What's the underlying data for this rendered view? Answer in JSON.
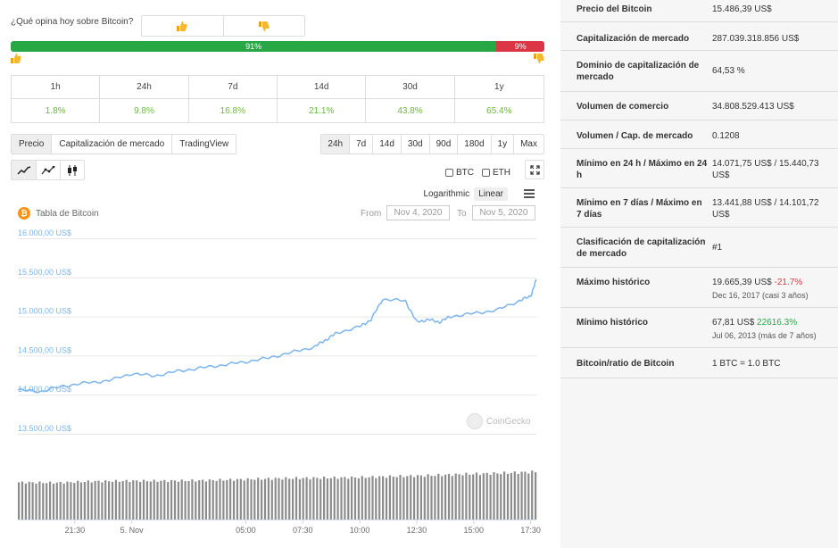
{
  "poll": {
    "question": "¿Qué opina hoy sobre Bitcoin?",
    "up_icon": "thumbs-up",
    "down_icon": "thumbs-down",
    "positive_pct": 91,
    "negative_pct": 9,
    "positive_label": "91%",
    "negative_label": "9%",
    "positive_color": "#28a745",
    "negative_color": "#dc3545"
  },
  "performance": {
    "periods": [
      "1h",
      "24h",
      "7d",
      "14d",
      "30d",
      "1y"
    ],
    "changes": [
      "1.8%",
      "9.8%",
      "16.8%",
      "21.1%",
      "43.8%",
      "65.4%"
    ]
  },
  "tabs": [
    "Precio",
    "Capitalización de mercado",
    "TradingView"
  ],
  "ranges": [
    "24h",
    "7d",
    "14d",
    "30d",
    "90d",
    "180d",
    "1y",
    "Max"
  ],
  "compare": {
    "btc": "BTC",
    "eth": "ETH"
  },
  "scale": {
    "log": "Logarithmic",
    "linear": "Linear"
  },
  "chart_header": {
    "title": "Tabla de Bitcoin",
    "from_label": "From",
    "from_value": "Nov 4, 2020",
    "to_label": "To",
    "to_value": "Nov 5, 2020",
    "watermark": "CoinGecko"
  },
  "chart_data": {
    "type": "line",
    "title": "Tabla de Bitcoin",
    "y_ticks": [
      "16.000,00 US$",
      "15.500,00 US$",
      "15.000,00 US$",
      "14.500,00 US$",
      "14.000,00 US$",
      "13.500,00 US$"
    ],
    "y_tick_values": [
      16000,
      15500,
      15000,
      14500,
      14000,
      13500
    ],
    "ylim": [
      13500,
      16000
    ],
    "x_ticks": [
      "21:30",
      "5. Nov",
      "05:00",
      "07:30",
      "10:00",
      "12:30",
      "15:00",
      "17:30"
    ],
    "series": [
      {
        "x": [
          "19:00",
          "20:00",
          "21:00",
          "22:00",
          "23:00",
          "00:00",
          "01:00",
          "02:00",
          "03:00",
          "04:00",
          "05:00",
          "06:00",
          "07:00",
          "08:00",
          "08:30",
          "09:00",
          "10:00",
          "10:30",
          "11:00",
          "12:00",
          "12:30",
          "13:00",
          "13:30",
          "14:00",
          "15:00",
          "16:00",
          "17:00",
          "17:30",
          "17:45"
        ],
        "values": [
          14060,
          14040,
          14110,
          14150,
          14180,
          14270,
          14240,
          14300,
          14340,
          14380,
          14420,
          14470,
          14540,
          14610,
          14700,
          14790,
          14870,
          14960,
          15220,
          15200,
          14930,
          14960,
          14930,
          15000,
          15040,
          15080,
          15200,
          15260,
          15470
        ],
        "color": "#7cb5ec"
      }
    ],
    "volume_color": "#8c8c8c",
    "volume_relative": [
      0.78,
      0.77,
      0.8,
      0.81,
      0.81,
      0.82,
      0.84,
      0.86,
      0.87,
      0.88,
      0.9,
      0.92,
      0.95,
      0.97,
      1.0
    ],
    "grid": true
  },
  "stats": [
    {
      "label": "Precio del Bitcoin",
      "value": "15.486,39 US$"
    },
    {
      "label": "Capitalización de mercado",
      "value": "287.039.318.856 US$"
    },
    {
      "label": "Dominio de capitalización de mercado",
      "value": "64,53 %"
    },
    {
      "label": "Volumen de comercio",
      "value": "34.808.529.413 US$"
    },
    {
      "label": "Volumen / Cap. de mercado",
      "value": "0.1208"
    },
    {
      "label": "Mínimo en 24 h / Máximo en 24 h",
      "value": "14.071,75 US$ / 15.440,73 US$"
    },
    {
      "label": "Mínimo en 7 días / Máximo en 7 días",
      "value": "13.441,88 US$ / 14.101,72 US$"
    },
    {
      "label": "Clasificación de capitalización de mercado",
      "value": "#1"
    },
    {
      "label": "Máximo histórico",
      "value": "19.665,39 US$",
      "change": "-21.7%",
      "sub": "Dec 16, 2017 (casi 3 años)"
    },
    {
      "label": "Mínimo histórico",
      "value": "67,81 US$",
      "change": "22616.3%",
      "sub": "Jul 06, 2013 (más de 7 años)"
    },
    {
      "label": "Bitcoin/ratio de Bitcoin",
      "value": "1 BTC = 1.0 BTC"
    }
  ]
}
